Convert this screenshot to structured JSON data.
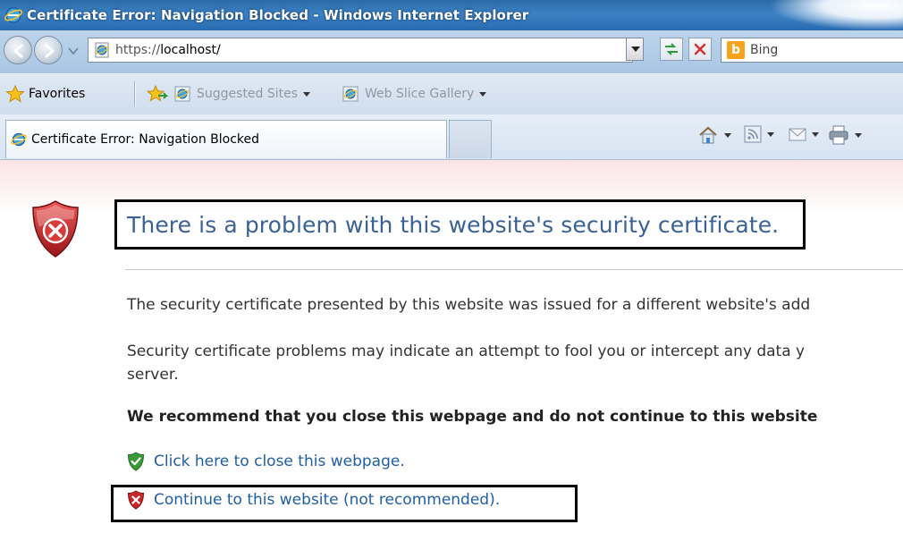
{
  "window": {
    "title": "Certificate Error: Navigation Blocked - Windows Internet Explorer"
  },
  "address_bar": {
    "url_scheme": "https://",
    "url_host": "localhost/",
    "search_provider": "Bing",
    "search_logo_letter": "b",
    "icons": [
      "back-icon",
      "forward-icon",
      "recent-pages-icon",
      "page-icon",
      "refresh-icon",
      "stop-icon",
      "bing-icon"
    ]
  },
  "favorites_bar": {
    "favorites_label": "Favorites",
    "suggested_sites": "Suggested Sites",
    "web_slice_gallery": "Web Slice Gallery"
  },
  "tabs": [
    {
      "label": "Certificate Error: Navigation Blocked",
      "active": true
    }
  ],
  "command_bar": {
    "icons": [
      "home-icon",
      "feeds-icon",
      "mail-icon",
      "print-icon"
    ]
  },
  "content": {
    "heading": "There is a problem with this website's security certificate.",
    "paragraph1": "The security certificate presented by this website was issued for a different website's add",
    "paragraph2_line1": "Security certificate problems may indicate an attempt to fool you or intercept any data y",
    "paragraph2_line2": "server.",
    "recommendation": "We recommend that you close this webpage and do not continue to this website",
    "close_link": "Click here to close this webpage.",
    "continue_link": "Continue to this website (not recommended)."
  },
  "colors": {
    "heading": "#3b6295",
    "link": "#1f5fa3",
    "title_bar": "#2f73b8",
    "error_shield": "#c8282c",
    "ok_shield": "#3a9a3a"
  }
}
